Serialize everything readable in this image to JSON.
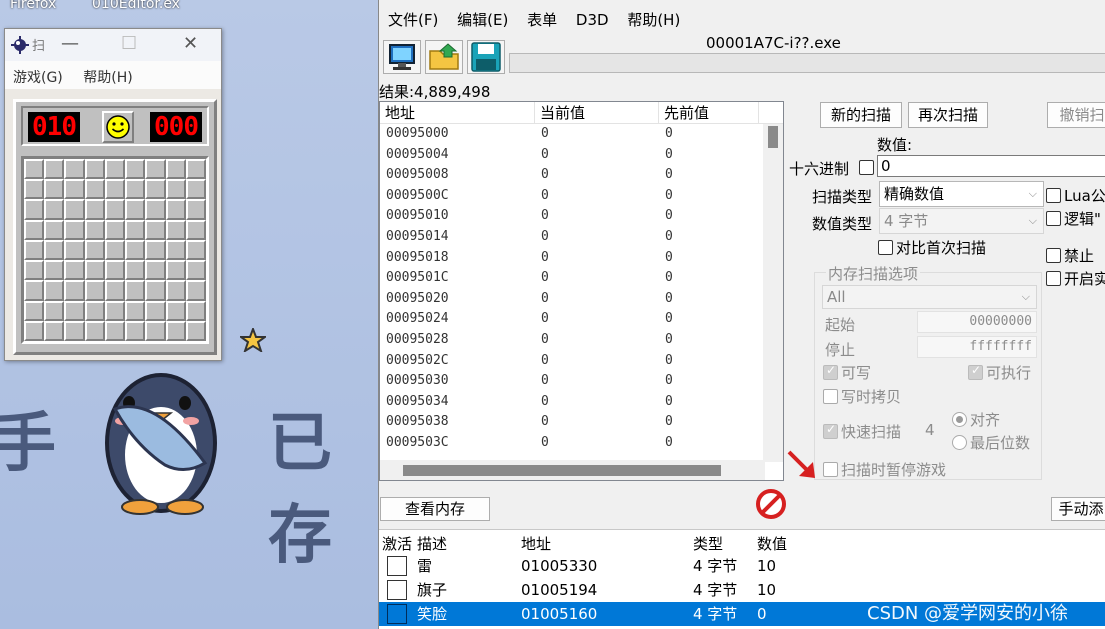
{
  "desktop": {
    "icons": [
      "Firefox",
      "010Editor.ex"
    ],
    "sticker_text_left": "手",
    "sticker_text_right": "已存"
  },
  "minesweeper": {
    "title": "扫",
    "menu": [
      "游戏(G)",
      "帮助(H)"
    ],
    "mine_counter": "010",
    "timer": "000",
    "rows": 9,
    "cols": 9
  },
  "cheat_engine": {
    "menu": [
      "文件(F)",
      "编辑(E)",
      "表单",
      "D3D",
      "帮助(H)"
    ],
    "process_title": "00001A7C-i??.exe",
    "results_label": "结果:4,889,498",
    "results_columns": [
      "地址",
      "当前值",
      "先前值"
    ],
    "results": [
      [
        "00095000",
        "0",
        "0"
      ],
      [
        "00095004",
        "0",
        "0"
      ],
      [
        "00095008",
        "0",
        "0"
      ],
      [
        "0009500C",
        "0",
        "0"
      ],
      [
        "00095010",
        "0",
        "0"
      ],
      [
        "00095014",
        "0",
        "0"
      ],
      [
        "00095018",
        "0",
        "0"
      ],
      [
        "0009501C",
        "0",
        "0"
      ],
      [
        "00095020",
        "0",
        "0"
      ],
      [
        "00095024",
        "0",
        "0"
      ],
      [
        "00095028",
        "0",
        "0"
      ],
      [
        "0009502C",
        "0",
        "0"
      ],
      [
        "00095030",
        "0",
        "0"
      ],
      [
        "00095034",
        "0",
        "0"
      ],
      [
        "00095038",
        "0",
        "0"
      ],
      [
        "0009503C",
        "0",
        "0"
      ]
    ],
    "scan": {
      "new_scan": "新的扫描",
      "next_scan": "再次扫描",
      "undo_scan": "撤销扫",
      "value_label": "数值:",
      "hex_label": "十六进制",
      "value": "0",
      "scan_type_label": "扫描类型",
      "scan_type": "精确数值",
      "value_type_label": "数值类型",
      "value_type": "4 字节",
      "compare_first": "对比首次扫描",
      "lua": "Lua公",
      "logic": "逻辑\"",
      "disable": "禁止",
      "enable": "开启实"
    },
    "memory_options": {
      "title": "内存扫描选项",
      "region": "All",
      "start_label": "起始",
      "start": "00000000",
      "stop_label": "停止",
      "stop": "ffffffff",
      "writable": "可写",
      "executable": "可执行",
      "copy_on_write": "写时拷贝",
      "fast_scan": "快速扫描",
      "fast_scan_value": "4",
      "align": "对齐",
      "last_digits": "最后位数",
      "pause_game": "扫描时暂停游戏"
    },
    "view_memory": "查看内存",
    "manual_add": "手动添",
    "address_list": {
      "columns": [
        "激活",
        "描述",
        "地址",
        "类型",
        "数值"
      ],
      "rows": [
        {
          "desc": "雷",
          "address": "01005330",
          "type": "4 字节",
          "value": "10"
        },
        {
          "desc": "旗子",
          "address": "01005194",
          "type": "4 字节",
          "value": "10"
        },
        {
          "desc": "笑脸",
          "address": "01005160",
          "type": "4 字节",
          "value": "0"
        }
      ],
      "selected_index": 2
    },
    "watermark": "CSDN @爱学网安的小徐"
  },
  "colors": {
    "selection": "#0078d7",
    "lcd_red": "#ff0000",
    "desktop": "#aebfe0"
  }
}
